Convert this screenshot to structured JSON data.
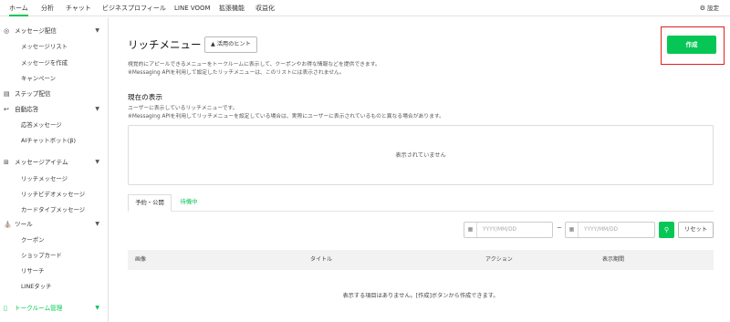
{
  "topnav": {
    "tabs": [
      {
        "label": "ホーム",
        "active": true
      },
      {
        "label": "分析"
      },
      {
        "label": "チャット"
      },
      {
        "label": "ビジネスプロフィール"
      },
      {
        "label": "LINE VOOM"
      },
      {
        "label": "拡張機能"
      },
      {
        "label": "収益化"
      }
    ],
    "settings_label": "設定",
    "settings_icon": "gear-icon"
  },
  "sidebar": {
    "groups": [
      {
        "label": "メッセージ配信",
        "icon": "message-icon",
        "items": [
          "メッセージリスト",
          "メッセージを作成",
          "キャンペーン"
        ]
      },
      {
        "label": "ステップ配信",
        "icon": "step-chart-icon"
      },
      {
        "label": "自動応答",
        "icon": "reply-icon",
        "items": [
          "応答メッセージ",
          "AIチャットボット(β)"
        ]
      },
      {
        "label": "メッセージアイテム",
        "icon": "add-box-icon",
        "items": [
          "リッチメッセージ",
          "リッチビデオメッセージ",
          "カードタイプメッセージ"
        ]
      },
      {
        "label": "ツール",
        "icon": "store-icon",
        "items": [
          "クーポン",
          "ショップカード",
          "リサーチ",
          "LINEタッチ"
        ]
      },
      {
        "label": "トークルーム管理",
        "icon": "chat-room-icon",
        "highlight_color": "#06c755"
      }
    ]
  },
  "main": {
    "title": "リッチメニュー",
    "hint_button": "活用のヒント",
    "create_button": "作成",
    "description": [
      "視覚的にアピールできるメニューをトークルームに表示して、クーポンやお得な情報などを提供できます。",
      "※Messaging APIを利用して設定したリッチメニューは、このリストには表示されません。"
    ],
    "current_section": {
      "title": "現在の表示",
      "lines": [
        "ユーザーに表示しているリッチメニューです。",
        "※Messaging APIを利用してリッチメニューを設定している場合は、実際にユーザーに表示されているものと異なる場合があります。"
      ],
      "empty_text": "表示されていません"
    },
    "tabs": [
      {
        "label": "予約・公開",
        "active": true
      },
      {
        "label": "待機中"
      }
    ],
    "filter": {
      "date_from_placeholder": "YYYY/MM/DD",
      "separator": "~",
      "date_to_placeholder": "YYYY/MM/DD",
      "reset_label": "リセット"
    },
    "table": {
      "headers": [
        "画像",
        "タイトル",
        "アクション",
        "表示期間"
      ],
      "empty_text": "表示する項目はありません。[作成]ボタンから作成できます。"
    }
  },
  "colors": {
    "brand_green": "#06c755",
    "highlight_border": "#e02020"
  }
}
